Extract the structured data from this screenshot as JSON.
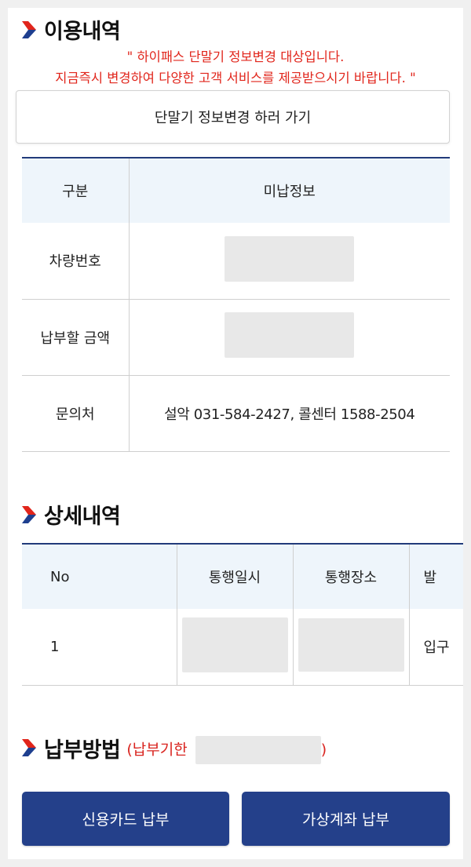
{
  "usage": {
    "title": "이용내역",
    "notice_line1": "\" 하이패스 단말기 정보변경 대상입니다.",
    "notice_line2": "지금즉시 변경하여 다양한 고객 서비스를 제공받으시기 바랍니다. \"",
    "change_button": "단말기 정보변경 하러 가기",
    "table": {
      "headers": [
        "구분",
        "미납정보"
      ],
      "rows": [
        {
          "label": "차량번호",
          "value": ""
        },
        {
          "label": "납부할 금액",
          "value": ""
        },
        {
          "label": "문의처",
          "value": "설악 031-584-2427, 콜센터 1588-2504"
        }
      ]
    }
  },
  "detail": {
    "title": "상세내역",
    "table": {
      "headers": [
        "No",
        "통행일시",
        "통행장소",
        "발"
      ],
      "rows": [
        {
          "no": "1",
          "datetime": "",
          "place": "",
          "extra": "입구"
        }
      ]
    }
  },
  "payment": {
    "title": "납부방법",
    "deadline_prefix": "(납부기한",
    "deadline_suffix": ")",
    "card_button": "신용카드 납부",
    "virtual_account_button": "가상계좌 납부"
  },
  "colors": {
    "accent_navy": "#24408a",
    "notice_red": "#e1251b",
    "chevron_red": "#e1251b",
    "chevron_blue": "#1e3f8f"
  }
}
